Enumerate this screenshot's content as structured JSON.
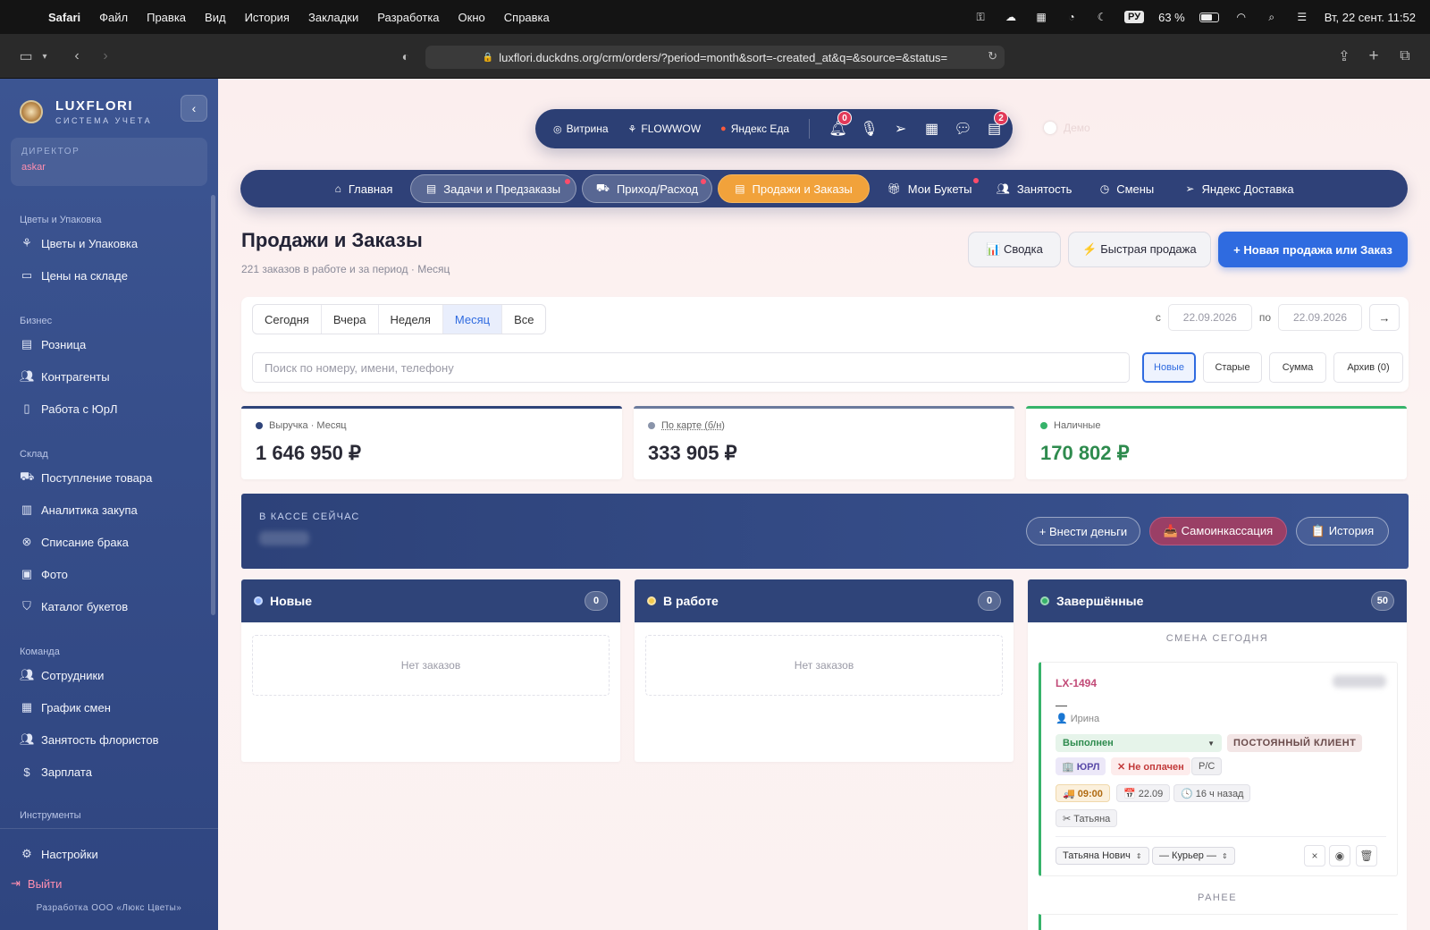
{
  "menubar": {
    "app": "Safari",
    "items": [
      "Файл",
      "Правка",
      "Вид",
      "История",
      "Закладки",
      "Разработка",
      "Окно",
      "Справка"
    ],
    "lang": "РУ",
    "battery": "63 %",
    "datetime": "Вт, 22 сент. 11:52"
  },
  "browser": {
    "url": "luxflori.duckdns.org/crm/orders/?period=month&sort=-created_at&q=&source=&status="
  },
  "sidebar": {
    "brand_name": "LUXFLORI",
    "brand_sub": "СИСТЕМА УЧЕТА",
    "role": "ДИРЕКТОР",
    "user": "askar",
    "sections": [
      {
        "label": "Цветы и Упаковка",
        "items": [
          {
            "label": "Цветы и Упаковка",
            "icon": "flower-icon"
          },
          {
            "label": "Цены на складе",
            "icon": "monitor-icon"
          }
        ]
      },
      {
        "label": "Бизнес",
        "items": [
          {
            "label": "Розница",
            "icon": "clipboard-icon"
          },
          {
            "label": "Контрагенты",
            "icon": "users-icon"
          },
          {
            "label": "Работа с ЮрЛ",
            "icon": "document-icon"
          }
        ]
      },
      {
        "label": "Склад",
        "items": [
          {
            "label": "Поступление товара",
            "icon": "truck-icon"
          },
          {
            "label": "Аналитика закупа",
            "icon": "bar-chart-icon"
          },
          {
            "label": "Списание брака",
            "icon": "cancel-circle-icon"
          },
          {
            "label": "Фото",
            "icon": "image-icon"
          },
          {
            "label": "Каталог букетов",
            "icon": "shield-icon"
          }
        ]
      },
      {
        "label": "Команда",
        "items": [
          {
            "label": "Сотрудники",
            "icon": "users-icon"
          },
          {
            "label": "График смен",
            "icon": "calendar-icon"
          },
          {
            "label": "Занятость флористов",
            "icon": "users-icon"
          },
          {
            "label": "Зарплата",
            "icon": "dollar-icon"
          }
        ]
      },
      {
        "label": "Инструменты",
        "items": []
      }
    ],
    "settings": "Настройки",
    "logout": "Выйти",
    "footer": "Разработка ООО «Люкс Цветы»"
  },
  "topbar": {
    "sources": [
      "Витрина",
      "FLOWWOW",
      "Яндекс Еда"
    ],
    "notif_count": "0",
    "cart_count": "2",
    "demo_label": "Демо"
  },
  "nav": {
    "items": [
      {
        "label": "Главная",
        "icon": "home-icon"
      },
      {
        "label": "Задачи и Предзаказы",
        "icon": "clipboard-icon"
      },
      {
        "label": "Приход/Расход",
        "icon": "truck-icon"
      },
      {
        "label": "Продажи и Заказы",
        "icon": "clipboard-icon"
      },
      {
        "label": "Мои Букеты",
        "icon": "gift-icon"
      },
      {
        "label": "Занятость",
        "icon": "users-icon"
      },
      {
        "label": "Смены",
        "icon": "clock-icon"
      },
      {
        "label": "Яндекс Доставка",
        "icon": "send-icon"
      }
    ]
  },
  "page": {
    "title": "Продажи и Заказы",
    "subtitle": "221 заказов в работе и за период · Месяц",
    "btn_summary": "📊 Сводка",
    "btn_quick": "⚡ Быстрая продажа",
    "btn_new": "+ Новая продажа или Заказ"
  },
  "filters": {
    "periods": [
      "Сегодня",
      "Вчера",
      "Неделя",
      "Месяц",
      "Все"
    ],
    "active_period": "Месяц",
    "from_label": "с",
    "to_label": "по",
    "from_date": "22.09.2026",
    "to_date": "22.09.2026",
    "go": "→",
    "search_placeholder": "Поиск по номеру, имени, телефону",
    "sorts": [
      "Новые",
      "Старые",
      "Сумма",
      "Архив (0)"
    ]
  },
  "stats": [
    {
      "label": "Выручка · Месяц",
      "value": "1 646 950 ₽",
      "color": "#2f4479"
    },
    {
      "label": "По карте (б/н)",
      "value": "333 905 ₽",
      "color": "#6b7a9c"
    },
    {
      "label": "Наличные",
      "value": "170 802 ₽",
      "color": "#36b36a"
    }
  ],
  "cash": {
    "label": "В КАССЕ СЕЙЧАС",
    "btn_deposit": "+ Внести деньги",
    "btn_collect": "📥 Самоинкассация",
    "btn_history": "📋 История"
  },
  "columns": [
    {
      "title": "Новые",
      "count": "0",
      "empty": "Нет заказов",
      "dot": "#8fb4ff"
    },
    {
      "title": "В работе",
      "count": "0",
      "empty": "Нет заказов",
      "dot": "#f2c94c"
    },
    {
      "title": "Завершённые",
      "count": "50",
      "dot": "#36b36a"
    }
  ],
  "done": {
    "shift_label": "СМЕНА СЕГОДНЯ",
    "earlier_label": "РАНЕЕ",
    "order": {
      "number": "LX-1494",
      "dash": "—",
      "client": "👤 Ирина",
      "status": "Выполнен",
      "tag_regular": "ПОСТОЯННЫЙ КЛИЕНТ",
      "tag_legal": "🏢 ЮРЛ",
      "tag_unpaid": "✕ Не оплачен",
      "tag_rs": "Р/С",
      "time": "🚚 09:00",
      "date": "📅 22.09",
      "ago": "🕓 16 ч назад",
      "florist": "✂ Татьяна",
      "assignee": "Татьяна Нович",
      "courier": "— Курьер —"
    }
  }
}
